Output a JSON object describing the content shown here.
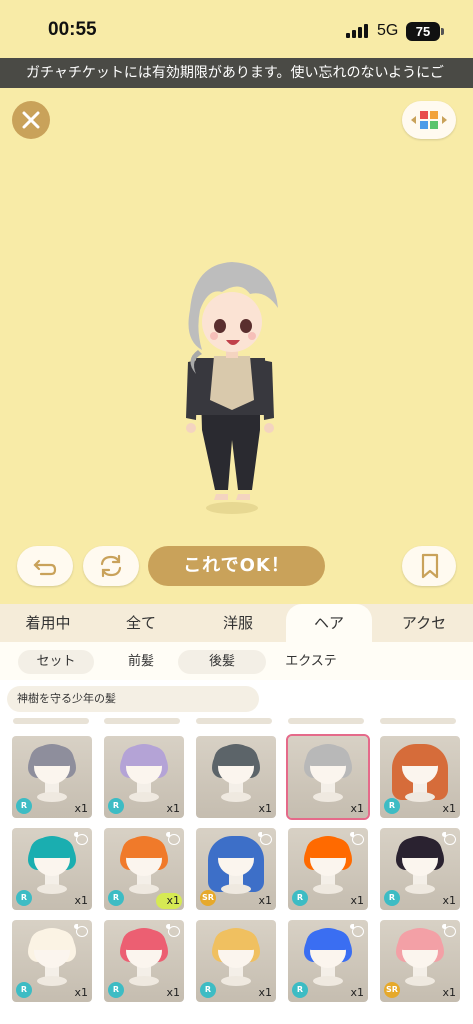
{
  "status": {
    "time": "00:55",
    "network": "5G",
    "battery": "75"
  },
  "ticker": {
    "text": "ガチャチケットには有効期限があります。使い忘れのないようにご"
  },
  "controls": {
    "ok_label": "これでOK！"
  },
  "categories": [
    "着用中",
    "全て",
    "洋服",
    "ヘア",
    "アクセ"
  ],
  "active_category": "ヘア",
  "subcategories": [
    "セット",
    "前髪",
    "後髪",
    "エクステ"
  ],
  "active_subcategory": "前髪",
  "item_name": "神樹を守る少年の髪",
  "items": [
    {
      "hair_color": "#8e8e9c",
      "style": "short",
      "rarity": "R",
      "count": "x1",
      "bear": false
    },
    {
      "hair_color": "#b4a3d6",
      "style": "short",
      "rarity": "R",
      "count": "x1",
      "bear": false
    },
    {
      "hair_color": "#5c6469",
      "style": "short",
      "rarity": "",
      "count": "x1",
      "bear": false
    },
    {
      "hair_color": "#b8b8b8",
      "style": "short",
      "rarity": "",
      "count": "x1",
      "bear": false,
      "selected": true
    },
    {
      "hair_color": "#d66c3a",
      "style": "long",
      "rarity": "R",
      "count": "x1",
      "bear": false
    },
    {
      "hair_color": "#1aaeb0",
      "style": "short",
      "rarity": "R",
      "count": "x1",
      "bear": true
    },
    {
      "hair_color": "#f07a2a",
      "style": "short",
      "rarity": "R",
      "count": "x1",
      "bear": true
    },
    {
      "hair_color": "#3d6fc8",
      "style": "long",
      "rarity": "SR",
      "count": "x1",
      "bear": true
    },
    {
      "hair_color": "#ff6a00",
      "style": "short",
      "rarity": "R",
      "count": "x1",
      "bear": true
    },
    {
      "hair_color": "#2a2230",
      "style": "short",
      "rarity": "R",
      "count": "x1",
      "bear": true
    },
    {
      "hair_color": "#fbf3e4",
      "style": "short",
      "rarity": "R",
      "count": "x1",
      "bear": true
    },
    {
      "hair_color": "#ec5f72",
      "style": "short",
      "rarity": "R",
      "count": "x1",
      "bear": true
    },
    {
      "hair_color": "#f0c060",
      "style": "short",
      "rarity": "R",
      "count": "x1",
      "bear": false
    },
    {
      "hair_color": "#3a6ef2",
      "style": "short",
      "rarity": "R",
      "count": "x1",
      "bear": true
    },
    {
      "hair_color": "#f3a0a6",
      "style": "short",
      "rarity": "SR",
      "count": "x1",
      "bear": true
    }
  ]
}
